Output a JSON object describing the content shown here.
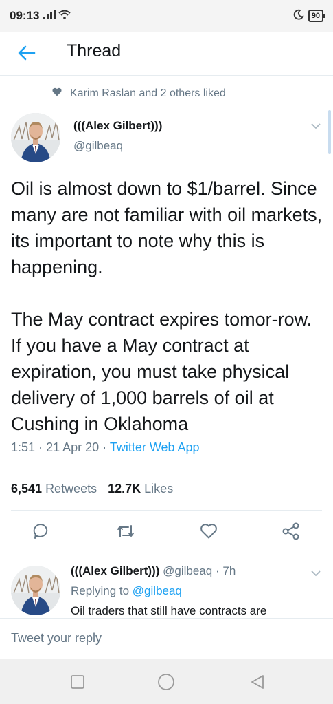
{
  "status_bar": {
    "time": "09:13",
    "battery": "90"
  },
  "header": {
    "title": "Thread"
  },
  "social_context": {
    "text": "Karim Raslan and 2 others liked"
  },
  "tweet": {
    "author_name": "(((Alex Gilbert)))",
    "author_handle": "@gilbeaq",
    "text": "Oil is almost down to $1/barrel. Since many are not familiar with oil markets, its important to note why this is happening.\n\nThe May contract expires tomor-row. If you have a May contract at expiration, you must take physical delivery of 1,000 barrels of oil at Cushing in Oklahoma",
    "time": "1:51",
    "date": "21 Apr 20",
    "app": "Twitter Web App",
    "retweets_count": "6,541",
    "retweets_label": "Retweets",
    "likes_count": "12.7K",
    "likes_label": "Likes"
  },
  "reply": {
    "author_name": "(((Alex Gilbert)))",
    "author_handle": "@gilbeaq",
    "age": "7h",
    "replying_prefix": "Replying to",
    "replying_to": "@gilbeaq",
    "text": "Oil traders that still have contracts are"
  },
  "compose": {
    "placeholder": "Tweet your reply"
  },
  "colors": {
    "accent": "#1da1f2",
    "secondary_text": "#657786",
    "primary_text": "#14171a"
  }
}
